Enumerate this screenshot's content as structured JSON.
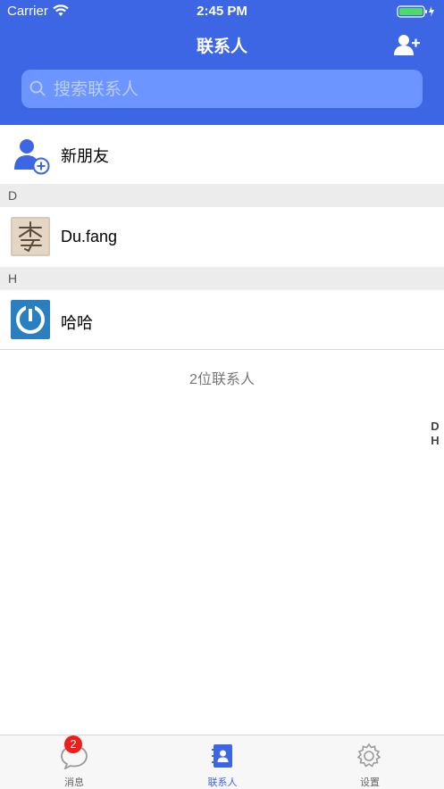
{
  "status_bar": {
    "carrier": "Carrier",
    "time": "2:45 PM"
  },
  "nav": {
    "title": "联系人",
    "add_icon": "add-user-icon"
  },
  "search": {
    "placeholder": "搜索联系人",
    "value": ""
  },
  "new_friends": {
    "label": "新朋友",
    "icon": "new-friend-icon"
  },
  "sections": [
    {
      "letter": "D",
      "contacts": [
        {
          "name": "Du.fang",
          "avatar": "calligraphy-avatar"
        }
      ]
    },
    {
      "letter": "H",
      "contacts": [
        {
          "name": "哈哈",
          "avatar": "power-logo-avatar"
        }
      ]
    }
  ],
  "contact_count": "2位联系人",
  "index_letters": [
    "D",
    "H"
  ],
  "tabs": [
    {
      "label": "消息",
      "icon": "chat-bubble-icon",
      "badge": "2",
      "active": false
    },
    {
      "label": "联系人",
      "icon": "contacts-book-icon",
      "active": true
    },
    {
      "label": "设置",
      "icon": "gear-icon",
      "active": false
    }
  ],
  "colors": {
    "accent": "#3c66e4",
    "search_bg": "#6c95ff",
    "badge": "#f01d1d",
    "section_bg": "#ececec"
  }
}
